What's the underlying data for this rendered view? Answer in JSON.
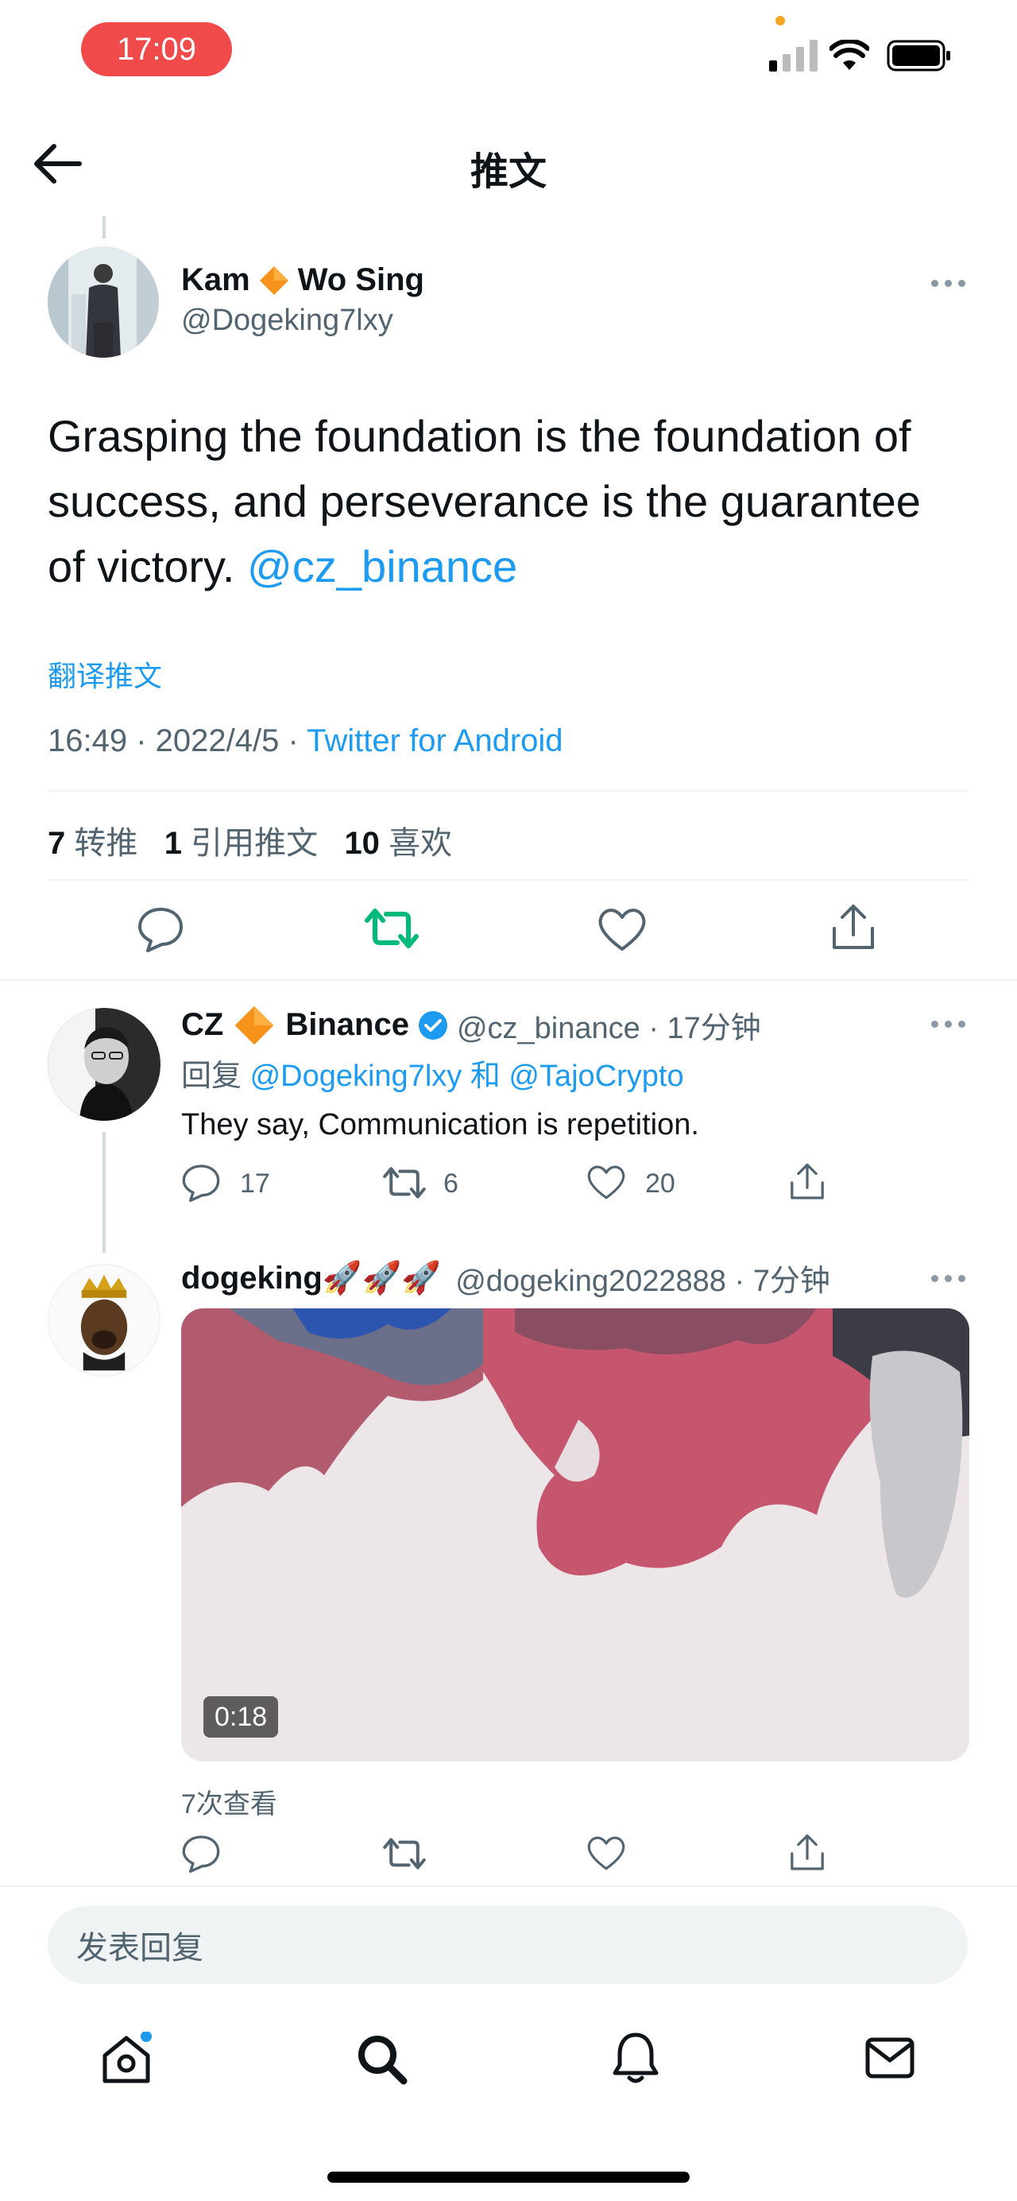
{
  "status_bar": {
    "time": "17:09"
  },
  "header": {
    "title": "推文"
  },
  "main_tweet": {
    "display_name_first": "Kam",
    "display_name_last": "Wo Sing",
    "handle": "@Dogeking7lxy",
    "text": "Grasping the foundation is the foundation of success, and perseverance is the guarantee of victory.",
    "mention": "@cz_binance",
    "translate_label": "翻译推文",
    "timestamp": "16:49 · 2022/4/5 · ",
    "source": "Twitter for Android",
    "stats": {
      "retweets_count": "7",
      "retweets_label": "转推",
      "quotes_count": "1",
      "quotes_label": "引用推文",
      "likes_count": "10",
      "likes_label": "喜欢"
    }
  },
  "replies": [
    {
      "display_name_first": "CZ",
      "display_name_last": "Binance",
      "handle_time": "@cz_binance · 17分钟",
      "reply_to_prefix": "回复 ",
      "reply_to_1": "@Dogeking7lxy",
      "reply_to_joiner": " 和 ",
      "reply_to_2": "@TajoCrypto",
      "text": "They say, Communication is repetition.",
      "reply_count": "17",
      "retweet_count": "6",
      "like_count": "20"
    },
    {
      "display_name": "dogeking🚀🚀🚀",
      "handle_time": "@dogeking2022888 · 7分钟",
      "video_duration": "0:18",
      "views": "7次查看"
    }
  ],
  "composer": {
    "placeholder": "发表回复"
  },
  "colors": {
    "accent": "#1d9bf0",
    "retweet_green": "#00ba7c",
    "time_pill": "#f04a4a",
    "diamond": "#f7931a"
  },
  "icons": [
    "back-arrow-icon",
    "more-icon",
    "reply-icon",
    "retweet-icon",
    "like-icon",
    "share-icon",
    "verified-icon",
    "diamond-icon",
    "home-icon",
    "search-icon",
    "bell-icon",
    "mail-icon"
  ]
}
